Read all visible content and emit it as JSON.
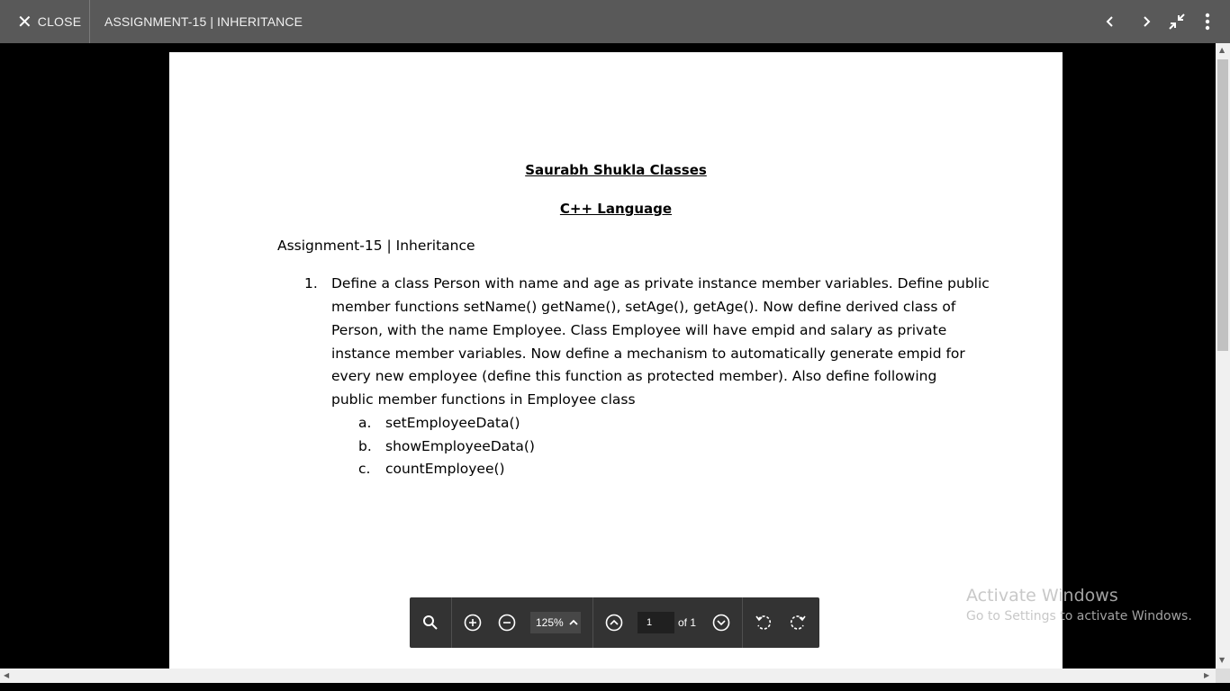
{
  "header": {
    "close_label": "CLOSE",
    "title": "ASSIGNMENT-15 | INHERITANCE",
    "icons": [
      "close-icon",
      "chevron-left-icon",
      "chevron-right-icon",
      "exit-fullscreen-icon",
      "more-vert-icon"
    ]
  },
  "document": {
    "heading1": "Saurabh Shukla Classes",
    "heading2": "C++ Language",
    "assignment": "Assignment-15 | Inheritance",
    "item_number": "1.",
    "item_lines": [
      "Define a class Person with name and age as private instance member variables. Define public",
      "member functions setName() getName(), setAge(), getAge(). Now define derived class of",
      "Person, with the name Employee. Class Employee will have empid and salary as private",
      "instance member variables. Now define a mechanism to automatically generate empid for",
      "every new employee (define this function as protected member). Also define following",
      "public member functions in Employee class"
    ],
    "subitems": [
      {
        "marker": "a.",
        "text": "setEmployeeData()"
      },
      {
        "marker": "b.",
        "text": "showEmployeeData()"
      },
      {
        "marker": "c.",
        "text": "countEmployee()"
      }
    ]
  },
  "toolbar": {
    "zoom": "125%",
    "page_value": "1",
    "page_of": "of 1",
    "icons": [
      "search-icon",
      "zoom-in-icon",
      "zoom-out-icon",
      "chevron-up-icon",
      "prev-page-icon",
      "next-page-icon",
      "rotate-left-icon",
      "rotate-right-icon"
    ]
  },
  "watermark": {
    "line1": "Activate Windows",
    "line2": "Go to Settings to activate Windows."
  },
  "colors": {
    "topbar": "#595959",
    "toolbar": "#333333",
    "background": "#000000"
  }
}
